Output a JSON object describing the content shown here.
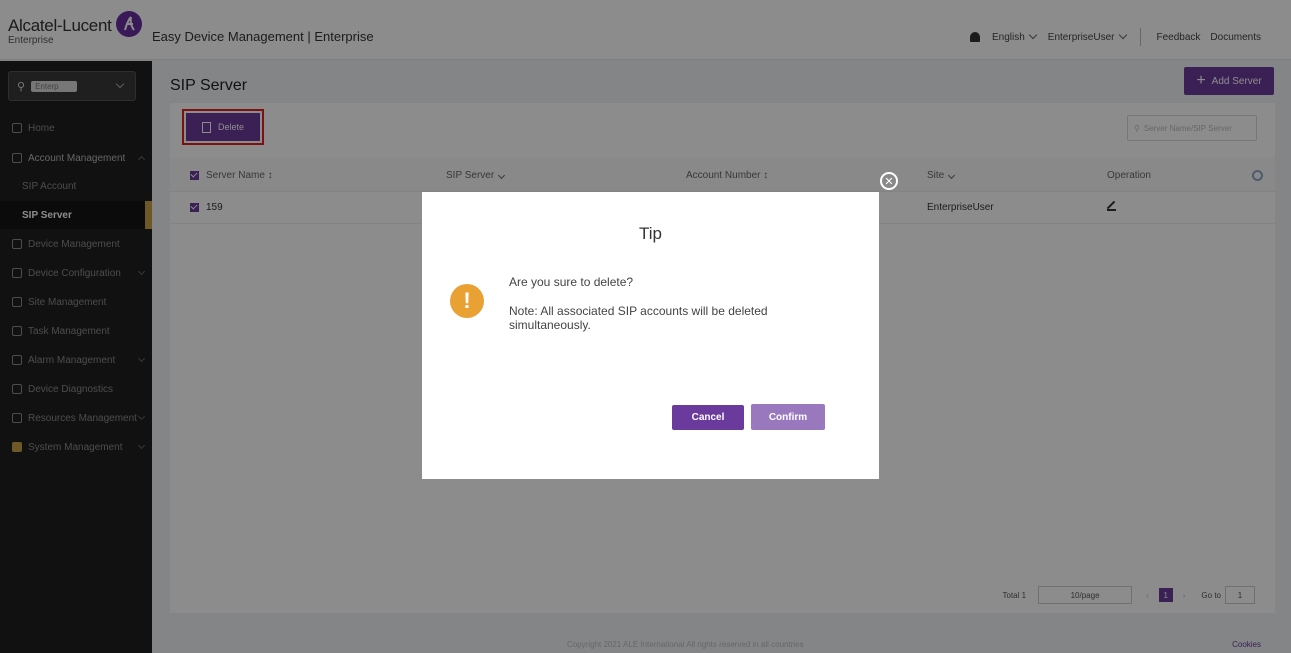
{
  "header": {
    "brand": "Alcatel-Lucent",
    "brand_sub": "Enterprise",
    "app_title": "Easy Device Management | Enterprise",
    "language": "English",
    "user": "EnterpriseUser",
    "feedback": "Feedback",
    "documents": "Documents"
  },
  "sidebar": {
    "search_tag": "Enterp",
    "items": [
      {
        "label": "Home"
      },
      {
        "label": "Account Management"
      },
      {
        "label": "SIP Account"
      },
      {
        "label": "SIP Server"
      },
      {
        "label": "Device Management"
      },
      {
        "label": "Device Configuration"
      },
      {
        "label": "Site Management"
      },
      {
        "label": "Task Management"
      },
      {
        "label": "Alarm Management"
      },
      {
        "label": "Device Diagnostics"
      },
      {
        "label": "Resources Management"
      },
      {
        "label": "System Management"
      }
    ]
  },
  "page": {
    "title": "SIP Server",
    "add_button": "Add Server",
    "delete_button": "Delete",
    "search_placeholder": "Server Name/SIP Server"
  },
  "table": {
    "columns": [
      "Server Name ↕",
      "SIP Server",
      "Account Number ↕",
      "Site",
      "Operation"
    ],
    "rows": [
      {
        "server_name": "159",
        "site": "EnterpriseUser"
      }
    ]
  },
  "pagination": {
    "total": "Total 1",
    "page_size": "10/page",
    "current_page": "1",
    "goto_label": "Go to",
    "goto_value": "1"
  },
  "footer": {
    "copyright": "Copyright 2021 ALE International All rights reserved in all countries",
    "cookies": "Cookies"
  },
  "dialog": {
    "title": "Tip",
    "message": "Are you sure to delete?",
    "note": "Note: All associated SIP accounts will be deleted simultaneously.",
    "cancel": "Cancel",
    "confirm": "Confirm"
  },
  "colors": {
    "primary": "#6a3b9c",
    "warning": "#e9a133",
    "sidebar_bg": "#1f1f1f",
    "active_indicator": "#c8a14a"
  }
}
